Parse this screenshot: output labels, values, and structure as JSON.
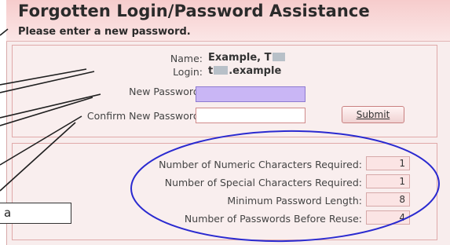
{
  "header": {
    "title": "Forgotten Login/Password Assistance",
    "subtitle": "Please enter a new password."
  },
  "account": {
    "name_label": "Name:",
    "name_value": "Example, T",
    "login_label": "Login:",
    "login_prefix": "t",
    "login_suffix": ".example"
  },
  "form": {
    "new_password_label": "New Password:",
    "new_password_value": "",
    "confirm_password_label": "Confirm New Password:",
    "confirm_password_value": "",
    "submit_label": "Submit"
  },
  "requirements": [
    {
      "label": "Number of Numeric Characters Required:",
      "value": "1"
    },
    {
      "label": "Number of Special Characters Required:",
      "value": "1"
    },
    {
      "label": "Minimum Password Length:",
      "value": "8"
    },
    {
      "label": "Number of Passwords Before Reuse:",
      "value": "4"
    }
  ],
  "annotation": {
    "callout_text": "a"
  },
  "colors": {
    "header_bg": "#f6cccc",
    "panel_bg": "#f9eeee",
    "border": "#e0a9a9",
    "focused_input": "#c9b6f5",
    "annotation_ellipse": "#2a2ad0"
  }
}
